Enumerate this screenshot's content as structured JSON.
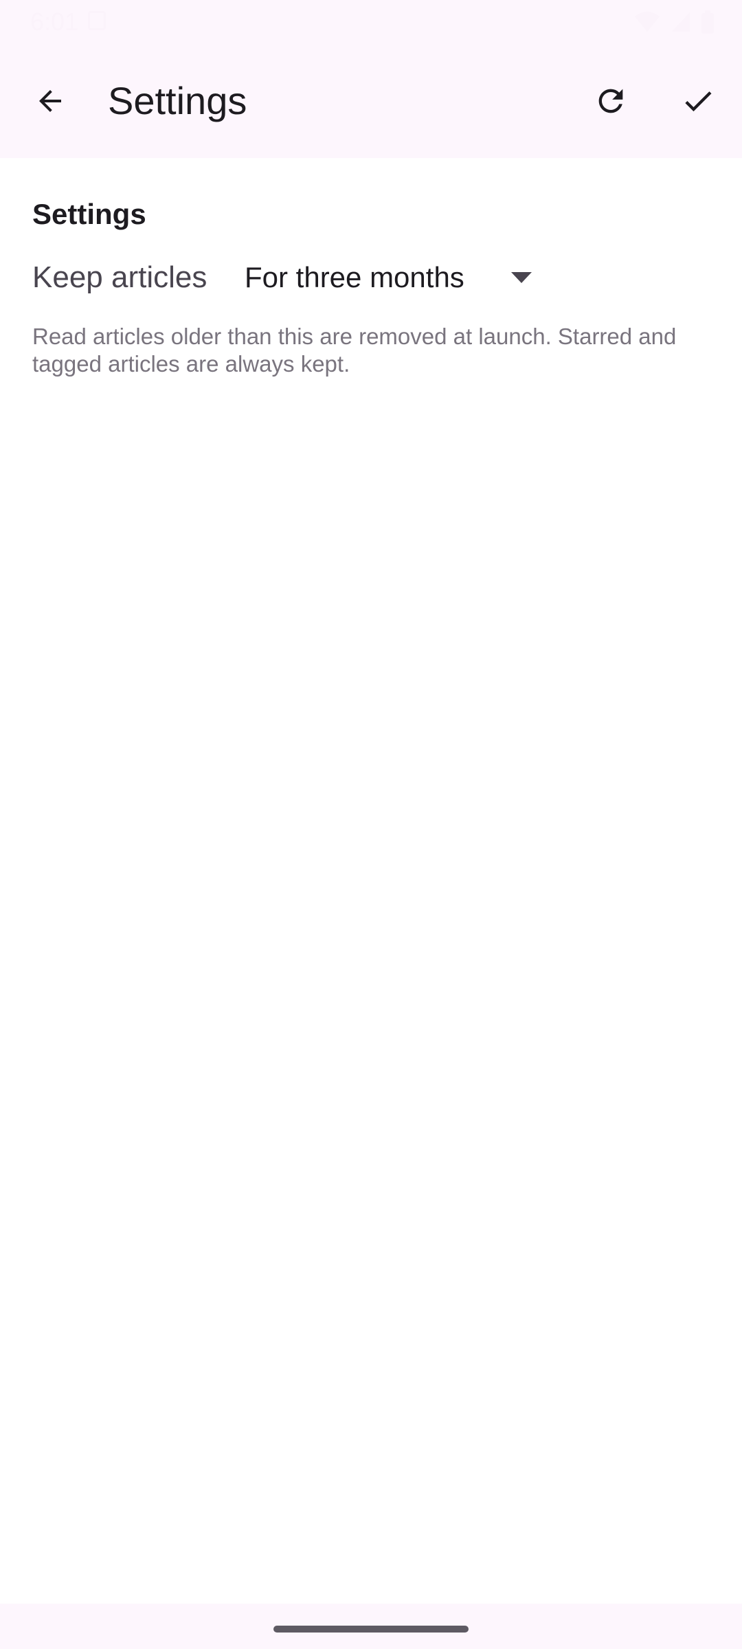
{
  "status_bar": {
    "time": "6:01",
    "icons": [
      "wifi-icon",
      "signal-icon",
      "battery-icon"
    ]
  },
  "app_bar": {
    "title": "Settings",
    "back_icon": "arrow-back-icon",
    "refresh_icon": "refresh-icon",
    "done_icon": "check-icon"
  },
  "settings": {
    "section_title": "Settings",
    "keep_articles": {
      "label": "Keep articles",
      "selected_value": "For three months",
      "help_text": "Read articles older than this are removed at launch. Starred and tagged articles are always kept."
    }
  },
  "colors": {
    "bar_background": "#fdf6fd",
    "text_primary": "#1d1b20",
    "text_secondary": "#79747e"
  }
}
